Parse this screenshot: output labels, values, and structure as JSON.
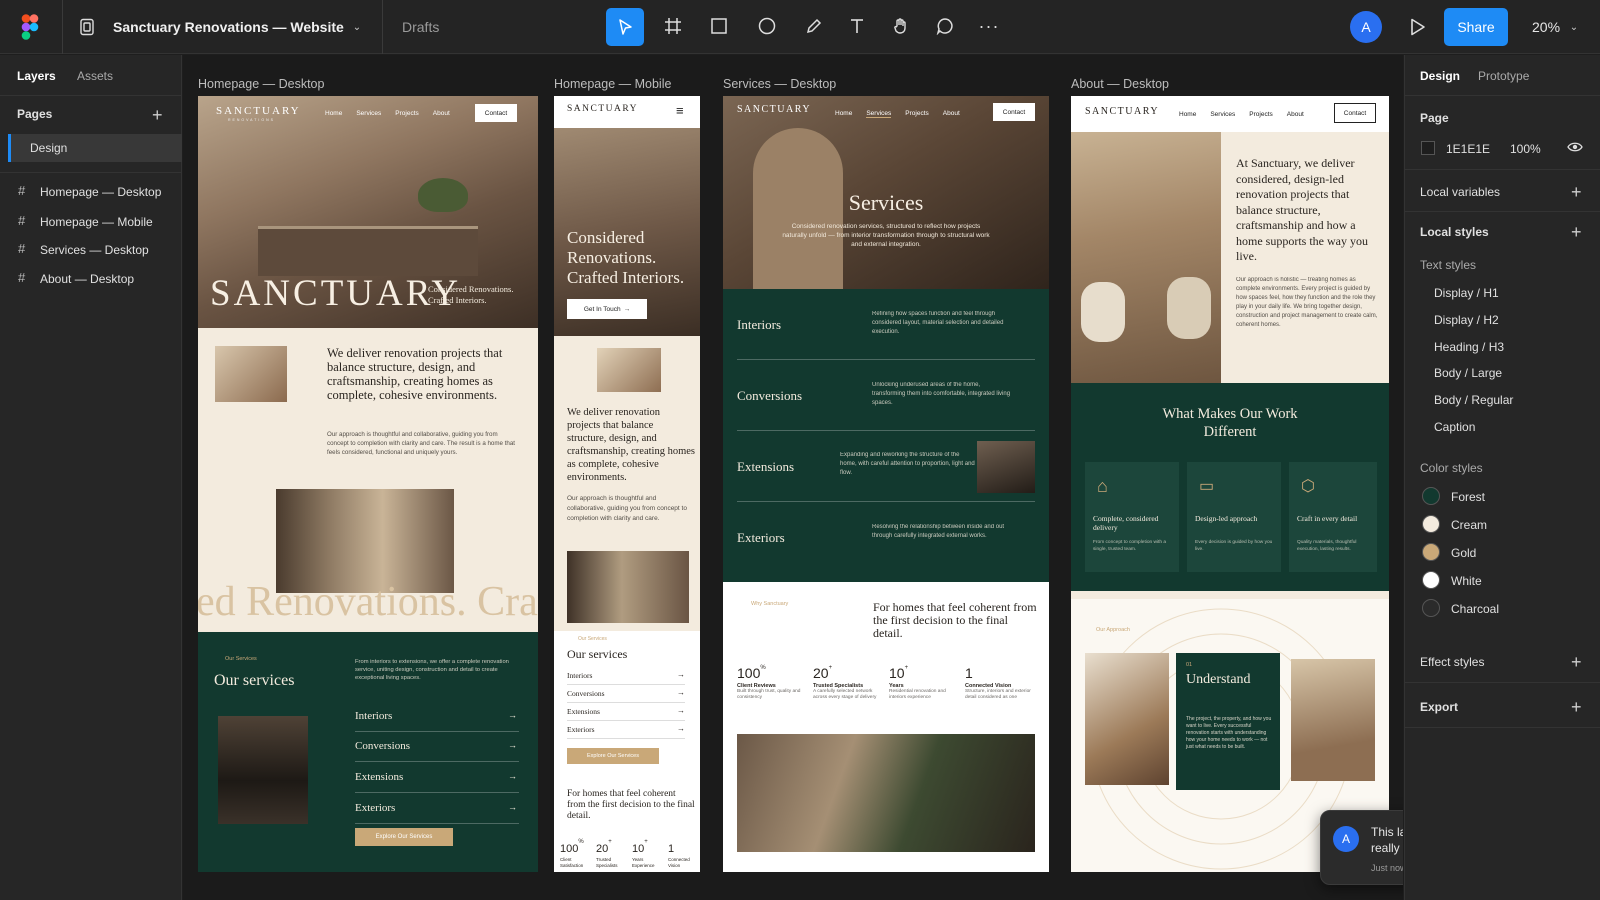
{
  "app": {
    "file_title": "Sanctuary Renovations — Website",
    "location": "Drafts",
    "share_label": "Share",
    "zoom": "20%",
    "avatar": "A"
  },
  "left_panel": {
    "tabs": [
      "Layers",
      "Assets"
    ],
    "pages_heading": "Pages",
    "pages": [
      "Design"
    ],
    "layers": [
      "Homepage — Desktop",
      "Homepage — Mobile",
      "Services — Desktop",
      "About — Desktop"
    ]
  },
  "right_panel": {
    "tabs": [
      "Design",
      "Prototype"
    ],
    "page_heading": "Page",
    "page_color": "1E1E1E",
    "page_opacity": "100%",
    "local_variables": "Local variables",
    "local_styles": "Local styles",
    "text_styles_heading": "Text styles",
    "text_styles": [
      "Display / H1",
      "Display / H2",
      "Heading / H3",
      "Body / Large",
      "Body / Regular",
      "Caption"
    ],
    "color_styles_heading": "Color styles",
    "color_styles": [
      {
        "name": "Forest",
        "color": "#12392f"
      },
      {
        "name": "Cream",
        "color": "#f3ebde"
      },
      {
        "name": "Gold",
        "color": "#c9a878"
      },
      {
        "name": "White",
        "color": "#ffffff"
      },
      {
        "name": "Charcoal",
        "color": "#2b2b2b"
      }
    ],
    "effect_styles": "Effect styles",
    "export": "Export"
  },
  "frames": {
    "home_desktop": {
      "label": "Homepage — Desktop",
      "logo": "SANCTUARY",
      "logo_sub": "RENOVATIONS",
      "nav": [
        "Home",
        "Services",
        "Projects",
        "About"
      ],
      "contact": "Contact",
      "hero_word": "SANCTUARY",
      "hero_tag": "Considered Renovations. Crafted Interiors.",
      "intro": "We deliver renovation projects that balance structure, design, and craftsmanship, creating homes as complete, cohesive environments.",
      "intro_body": "Our approach is thoughtful and collaborative, guiding you from concept to completion with clarity and care. The result is a home that feels considered, functional and uniquely yours.",
      "marquee": "ed Renovations. Cra",
      "services_kicker": "Our Services",
      "services_title": "Our services",
      "services_body": "From interiors to extensions, we offer a complete renovation service, uniting design, construction and detail to create exceptional living spaces.",
      "services": [
        "Interiors",
        "Conversions",
        "Extensions",
        "Exteriors"
      ],
      "cta": "Explore Our Services"
    },
    "home_mobile": {
      "label": "Homepage — Mobile",
      "logo": "SANCTUARY",
      "hero": "Considered Renovations. Crafted Interiors.",
      "cta_touch": "Get In Touch",
      "intro": "We deliver renovation projects that balance structure, design, and craftsmanship, creating homes as complete, cohesive environments.",
      "intro_body": "Our approach is thoughtful and collaborative, guiding you from concept to completion with clarity and care.",
      "services_kicker": "Our Services",
      "services_title": "Our services",
      "services": [
        "Interiors",
        "Conversions",
        "Extensions",
        "Exteriors"
      ],
      "cta": "Explore Our Services",
      "closing": "For homes that feel coherent from the first decision to the final detail.",
      "stats": [
        {
          "v": "100",
          "s": "%",
          "l": "Client Satisfaction"
        },
        {
          "v": "20",
          "s": "+",
          "l": "Trusted Specialists"
        },
        {
          "v": "10",
          "s": "+",
          "l": "Years Experience"
        },
        {
          "v": "1",
          "s": "",
          "l": "Connected Vision"
        }
      ]
    },
    "services_desktop": {
      "label": "Services — Desktop",
      "logo": "SANCTUARY",
      "nav": [
        "Home",
        "Services",
        "Projects",
        "About"
      ],
      "contact": "Contact",
      "title": "Services",
      "subtitle": "Considered renovation services, structured to reflect how projects naturally unfold — from interior transformation through to structural work and external integration.",
      "rows": [
        {
          "name": "Interiors",
          "desc": "Refining how spaces function and feel through considered layout, material selection and detailed execution."
        },
        {
          "name": "Conversions",
          "desc": "Unlocking underused areas of the home, transforming them into comfortable, integrated living spaces."
        },
        {
          "name": "Extensions",
          "desc": "Expanding and reworking the structure of the home, with careful attention to proportion, light and flow."
        },
        {
          "name": "Exteriors",
          "desc": "Resolving the relationship between inside and out through carefully integrated external works."
        }
      ],
      "why_kicker": "Why Sanctuary",
      "why_title": "For homes that feel coherent from the first decision to the final detail.",
      "stats": [
        {
          "v": "100",
          "s": "%",
          "l": "Client Reviews",
          "d": "Built through trust, quality and consistency"
        },
        {
          "v": "20",
          "s": "+",
          "l": "Trusted Specialists",
          "d": "A carefully selected network across every stage of delivery"
        },
        {
          "v": "10",
          "s": "+",
          "l": "Years",
          "d": "Residential renovation and interiors experience"
        },
        {
          "v": "1",
          "s": "",
          "l": "Connected Vision",
          "d": "Structure, interiors and exterior detail considered as one"
        }
      ]
    },
    "about_desktop": {
      "label": "About — Desktop",
      "logo": "SANCTUARY",
      "nav": [
        "Home",
        "Services",
        "Projects",
        "About"
      ],
      "contact": "Contact",
      "intro": "At Sanctuary, we deliver considered, design-led renovation projects that balance structure, craftsmanship and how a home supports the way you live.",
      "intro_body": "Our approach is holistic — treating homes as complete environments. Every project is guided by how spaces feel, how they function and the role they play in your daily life. We bring together design, construction and project management to create calm, coherent homes.",
      "diff_title": "What Makes Our Work Different",
      "cards": [
        {
          "title": "Complete, considered delivery",
          "body": "From concept to completion with a single, trusted team."
        },
        {
          "title": "Design-led approach",
          "body": "Every decision is guided by how you live."
        },
        {
          "title": "Craft in every detail",
          "body": "Quality materials, thoughtful execution, lasting results."
        }
      ],
      "approach_kicker": "Our Approach",
      "step_num": "01",
      "step_title": "Understand",
      "step_body": "The project, the property, and how you want to live. Every successful renovation starts with understanding how your home needs to work — not just what needs to be built."
    }
  },
  "comment": {
    "avatar": "A",
    "text": "This layout looks great — really captures the brand.",
    "time": "Just now"
  }
}
